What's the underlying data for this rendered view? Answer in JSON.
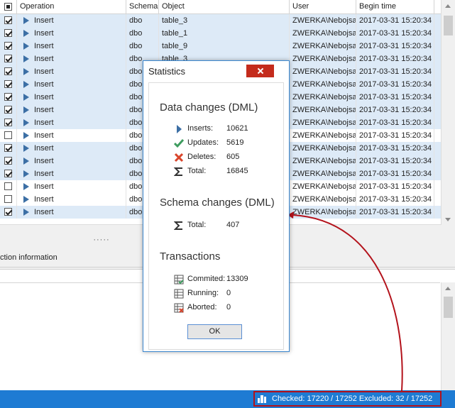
{
  "grid": {
    "columns": [
      "Operation",
      "Schema",
      "Object",
      "User",
      "Begin time"
    ],
    "rows": [
      {
        "checked": true,
        "operation": "Insert",
        "schema": "dbo",
        "object": "table_3",
        "user": "ZWERKA\\Nebojsa",
        "time": "2017-03-31 15:20:34"
      },
      {
        "checked": true,
        "operation": "Insert",
        "schema": "dbo",
        "object": "table_1",
        "user": "ZWERKA\\Nebojsa",
        "time": "2017-03-31 15:20:34"
      },
      {
        "checked": true,
        "operation": "Insert",
        "schema": "dbo",
        "object": "table_9",
        "user": "ZWERKA\\Nebojsa",
        "time": "2017-03-31 15:20:34"
      },
      {
        "checked": true,
        "operation": "Insert",
        "schema": "dbo",
        "object": "table_3",
        "user": "ZWERKA\\Nebojsa",
        "time": "2017-03-31 15:20:34"
      },
      {
        "checked": true,
        "operation": "Insert",
        "schema": "dbo",
        "object": "",
        "user": "ZWERKA\\Nebojsa",
        "time": "2017-03-31 15:20:34"
      },
      {
        "checked": true,
        "operation": "Insert",
        "schema": "dbo",
        "object": "",
        "user": "ZWERKA\\Nebojsa",
        "time": "2017-03-31 15:20:34"
      },
      {
        "checked": true,
        "operation": "Insert",
        "schema": "dbo",
        "object": "",
        "user": "ZWERKA\\Nebojsa",
        "time": "2017-03-31 15:20:34"
      },
      {
        "checked": true,
        "operation": "Insert",
        "schema": "dbo",
        "object": "",
        "user": "ZWERKA\\Nebojsa",
        "time": "2017-03-31 15:20:34"
      },
      {
        "checked": true,
        "operation": "Insert",
        "schema": "dbo",
        "object": "",
        "user": "ZWERKA\\Nebojsa",
        "time": "2017-03-31 15:20:34"
      },
      {
        "checked": false,
        "operation": "Insert",
        "schema": "dbo",
        "object": "",
        "user": "ZWERKA\\Nebojsa",
        "time": "2017-03-31 15:20:34"
      },
      {
        "checked": true,
        "operation": "Insert",
        "schema": "dbo",
        "object": "",
        "user": "ZWERKA\\Nebojsa",
        "time": "2017-03-31 15:20:34"
      },
      {
        "checked": true,
        "operation": "Insert",
        "schema": "dbo",
        "object": "",
        "user": "ZWERKA\\Nebojsa",
        "time": "2017-03-31 15:20:34"
      },
      {
        "checked": true,
        "operation": "Insert",
        "schema": "dbo",
        "object": "",
        "user": "ZWERKA\\Nebojsa",
        "time": "2017-03-31 15:20:34"
      },
      {
        "checked": false,
        "operation": "Insert",
        "schema": "dbo",
        "object": "",
        "user": "ZWERKA\\Nebojsa",
        "time": "2017-03-31 15:20:34"
      },
      {
        "checked": false,
        "operation": "Insert",
        "schema": "dbo",
        "object": "",
        "user": "ZWERKA\\Nebojsa",
        "time": "2017-03-31 15:20:34"
      },
      {
        "checked": true,
        "operation": "Insert",
        "schema": "dbo",
        "object": "",
        "user": "ZWERKA\\Nebojsa",
        "time": "2017-03-31 15:20:34"
      }
    ]
  },
  "splitter": "·····",
  "lower_tab": "ction information",
  "status": {
    "text": "Checked: 17220 / 17252   Excluded: 32 / 17252",
    "bar_color": "#1e7bd3",
    "highlight_color": "#b3121b"
  },
  "dialog": {
    "title": "Statistics",
    "dml": {
      "title": "Data changes (DML)",
      "items": [
        {
          "icon": "insert-arrow-icon",
          "label": "Inserts:",
          "value": "10621"
        },
        {
          "icon": "update-check-icon",
          "label": "Updates:",
          "value": "5619"
        },
        {
          "icon": "delete-x-icon",
          "label": "Deletes:",
          "value": "605"
        },
        {
          "icon": "sigma-icon",
          "label": "Total:",
          "value": "16845"
        }
      ]
    },
    "ddl": {
      "title": "Schema changes (DML)",
      "items": [
        {
          "icon": "sigma-icon",
          "label": "Total:",
          "value": "407"
        }
      ]
    },
    "transactions": {
      "title": "Transactions",
      "items": [
        {
          "icon": "committed-table-icon",
          "label": "Commited:",
          "value": "13309"
        },
        {
          "icon": "running-table-icon",
          "label": "Running:",
          "value": "0"
        },
        {
          "icon": "aborted-table-icon",
          "label": "Aborted:",
          "value": "0"
        }
      ]
    },
    "ok_label": "OK"
  }
}
